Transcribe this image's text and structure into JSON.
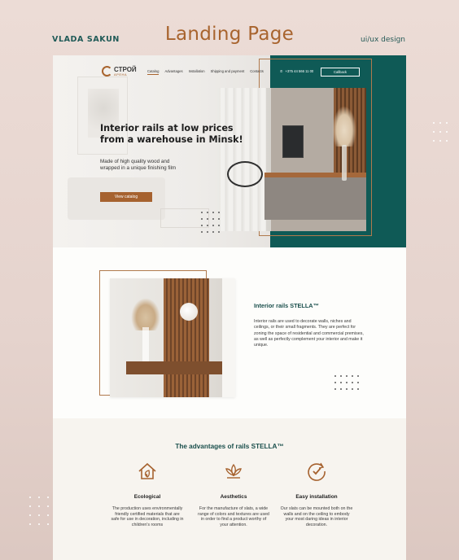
{
  "header": {
    "author": "VLADA SAKUN",
    "title": "Landing Page",
    "tag": "ui/ux design"
  },
  "site": {
    "logo": {
      "name": "СТРОЙ",
      "sub": "АРЕНА"
    },
    "nav": [
      "Catalog",
      "Advantages",
      "Installation",
      "Shipping and payment",
      "Contacts"
    ],
    "phone": "+375 44 566 11 00",
    "callback": "Callback",
    "hero": {
      "title": "Interior rails at low prices from a warehouse in Minsk!",
      "description": "Made of high quality wood and wrapped in a unique finishing film",
      "button": "View catalog"
    },
    "about": {
      "title": "Interior rails STELLA™",
      "text": "Interior rails are used to decorate walls, niches and ceilings, or their small fragments. They are perfect for zoning the space of residential and commercial premises, as well as perfectly complement your interior and make it unique."
    },
    "advantages": {
      "title": "The advantages of rails STELLA™",
      "items": [
        {
          "icon": "eco-house-icon",
          "name": "Ecological",
          "text": "The production uses environmentally friendly certified materials that are safe for use in decoration, including in children's rooms"
        },
        {
          "icon": "lotus-icon",
          "name": "Aesthetics",
          "text": "For the manufacture of slats, a wide range of colors and textures are used in order to find a product worthy of your attention."
        },
        {
          "icon": "clock-check-icon",
          "name": "Easy installation",
          "text": "Our slats can be mounted both on the walls and on the ceiling to embody your most daring ideas in interior decoration."
        }
      ]
    }
  },
  "colors": {
    "teal": "#0f5a56",
    "copper": "#a6622f",
    "background": "#e8d7d1"
  }
}
